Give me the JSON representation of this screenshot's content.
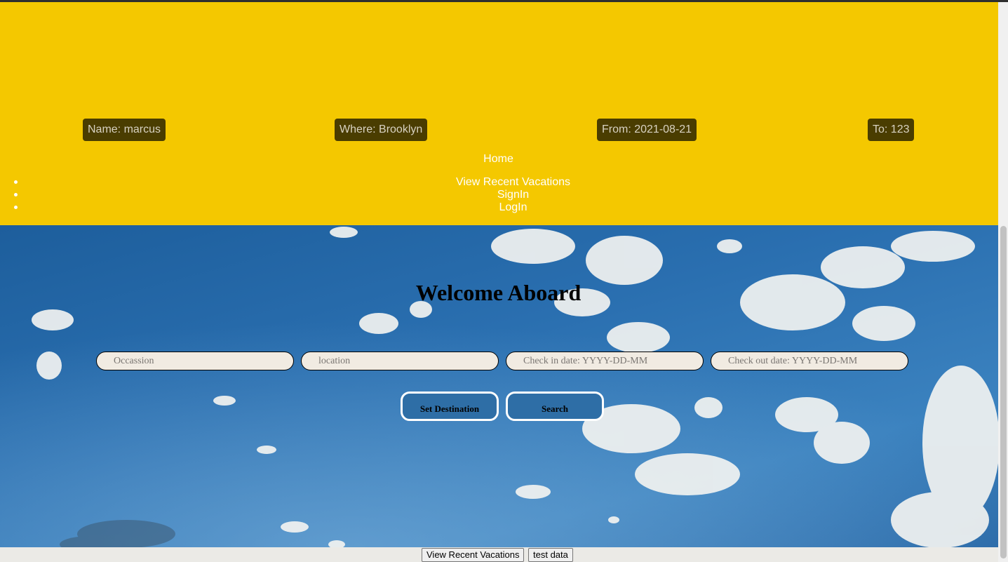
{
  "summary_badges": {
    "name": "Name: marcus",
    "where": "Where: Brooklyn",
    "from": "From: 2021-08-21",
    "to": "To: 123"
  },
  "nav": {
    "home": "Home",
    "items": [
      {
        "label": "View Recent Vacations"
      },
      {
        "label": "SignIn"
      },
      {
        "label": "LogIn"
      }
    ]
  },
  "hero": {
    "title": "Welcome Aboard",
    "fields": {
      "occasion_placeholder": "Occassion",
      "location_placeholder": "location",
      "checkin_placeholder": "Check in date: YYYY-DD-MM",
      "checkout_placeholder": "Check out date: YYYY-DD-MM"
    },
    "buttons": {
      "set_destination": "Set Destination",
      "search": "Search"
    }
  },
  "footer": {
    "view_recent_label": "View Recent Vacations",
    "test_data_label": "test data"
  },
  "colors": {
    "header_bg": "#f4c800",
    "badge_bg": "#4a3d00",
    "sky": "#2a6fb0"
  }
}
